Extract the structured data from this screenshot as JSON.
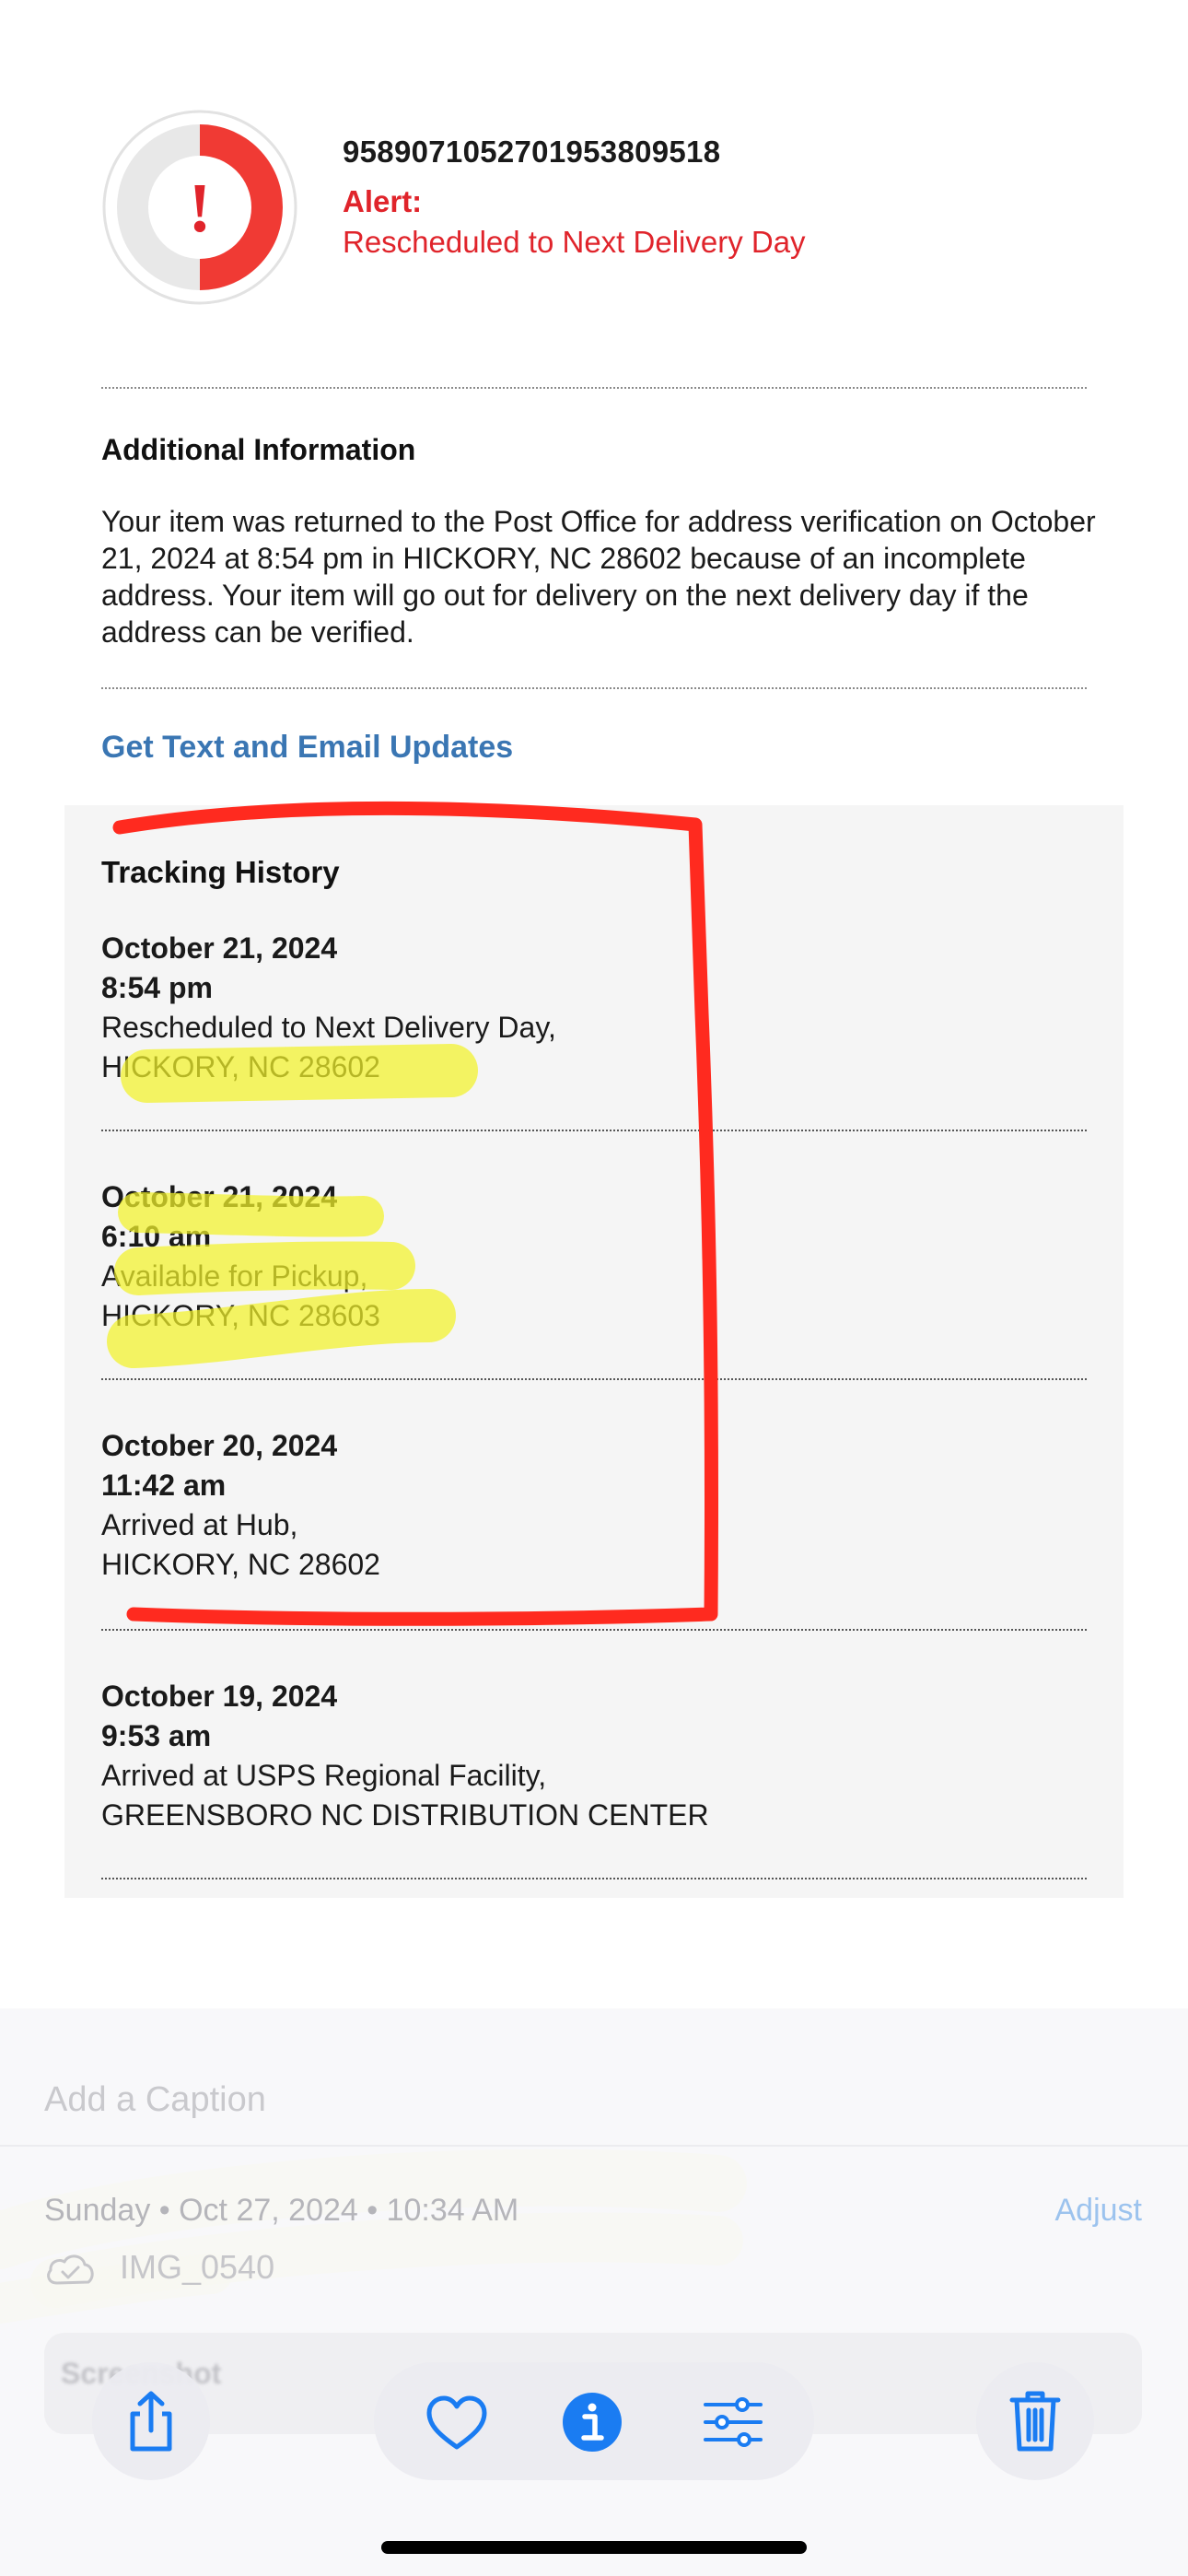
{
  "status": {
    "tracking_number": "9589071052701953809518",
    "alert_label": "Alert:",
    "alert_text": "Rescheduled to Next Delivery Day",
    "ring_color": "#f03a34"
  },
  "additional_info": {
    "title": "Additional Information",
    "text": "Your item was returned to the Post Office for address verification on October 21, 2024 at 8:54 pm in HICKORY, NC 28602 because of an incomplete address. Your item will go out for delivery on the next delivery day if the address can be verified."
  },
  "updates_link": "Get Text and Email Updates",
  "tracking_history": {
    "title": "Tracking History",
    "events": [
      {
        "date": "October 21, 2024",
        "time": "8:54 pm",
        "status": "Rescheduled to Next Delivery Day,",
        "location": "HICKORY, NC 28602"
      },
      {
        "date": "October 21, 2024",
        "time": "6:10 am",
        "status": "Available for Pickup,",
        "location": "HICKORY, NC 28603"
      },
      {
        "date": "October 20, 2024",
        "time": "11:42 am",
        "status": "Arrived at Hub,",
        "location": "HICKORY, NC 28602"
      },
      {
        "date": "October 19, 2024",
        "time": "9:53 am",
        "status": "Arrived at USPS Regional Facility,",
        "location": "GREENSBORO NC DISTRIBUTION CENTER"
      }
    ]
  },
  "photo_info": {
    "caption_placeholder": "Add a Caption",
    "date_line": "Sunday • Oct 27, 2024 • 10:34 AM",
    "adjust_label": "Adjust",
    "filename": "IMG_0540",
    "card_label": "Screenshot"
  },
  "colors": {
    "alert_red": "#e0242b",
    "link_blue": "#3a76b3",
    "ios_blue": "#1a7cf2",
    "annotation_red": "#ff2a1f",
    "highlighter_yellow": "#f3f22a"
  },
  "toolbar": {
    "share_icon": "share-icon",
    "favorite_icon": "heart-icon",
    "info_icon": "info-icon",
    "adjust_icon": "sliders-icon",
    "delete_icon": "trash-icon"
  }
}
